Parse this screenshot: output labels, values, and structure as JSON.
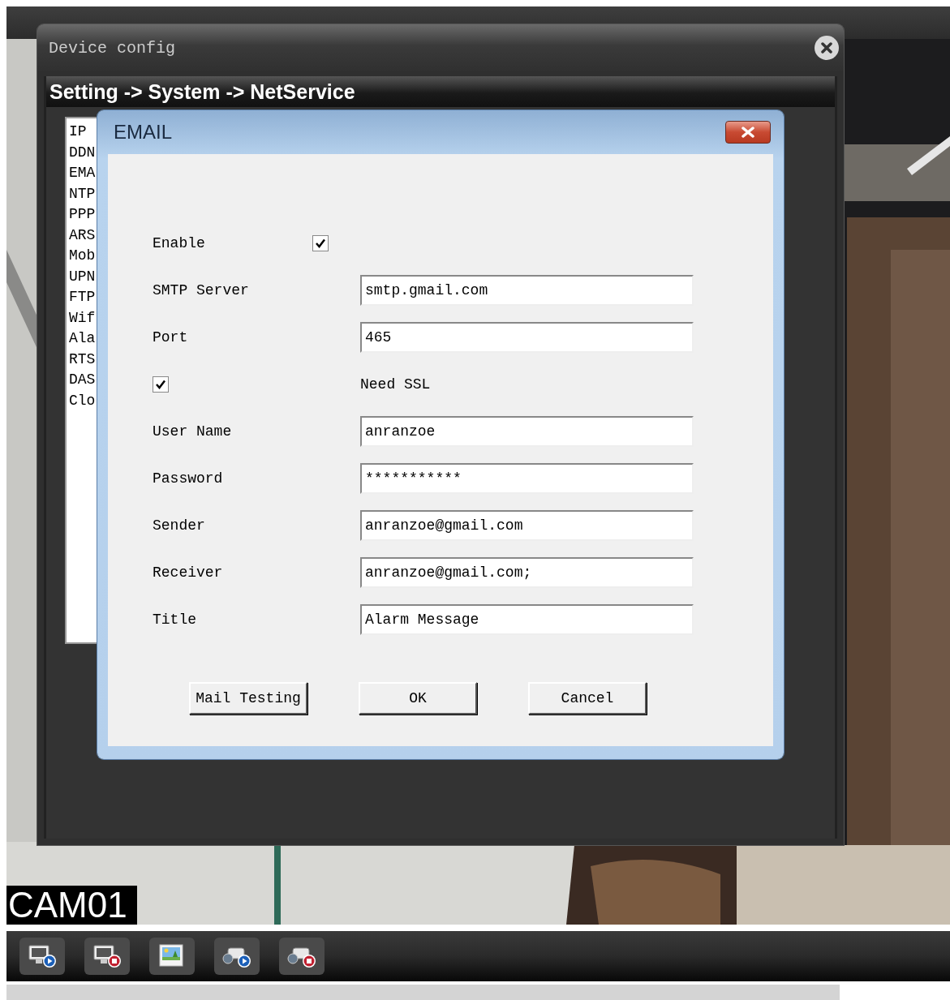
{
  "device_config": {
    "title": "Device config",
    "breadcrumb": "Setting -> System -> NetService",
    "services": [
      "IP",
      "DDN",
      "EMA",
      "NTP",
      "PPP",
      "ARS",
      "Mob",
      "UPN",
      "FTP",
      "Wif",
      "Ala",
      "RTS",
      "DAS",
      "Clo"
    ]
  },
  "email_dialog": {
    "title": "EMAIL",
    "rows": [
      {
        "kind": "checkbox",
        "label": "Enable",
        "checked": true
      },
      {
        "kind": "text",
        "label": "SMTP Server",
        "value": "smtp.gmail.com"
      },
      {
        "kind": "text",
        "label": "Port",
        "value": "465"
      },
      {
        "kind": "checkbox_first",
        "label": "Need SSL",
        "checked": true
      },
      {
        "kind": "text",
        "label": "User Name",
        "value": "anranzoe"
      },
      {
        "kind": "text",
        "label": "Password",
        "value": "***********"
      },
      {
        "kind": "text",
        "label": "Sender",
        "value": "anranzoe@gmail.com"
      },
      {
        "kind": "text",
        "label": "Receiver",
        "value": "anranzoe@gmail.com;"
      },
      {
        "kind": "text",
        "label": "Title",
        "value": "Alarm Message"
      }
    ],
    "buttons": [
      "Mail Testing",
      "OK",
      "Cancel"
    ]
  },
  "camera": {
    "label": "CAM01"
  },
  "toolbar": [
    {
      "kind": "monitor-play"
    },
    {
      "kind": "monitor-stop"
    },
    {
      "kind": "picture"
    },
    {
      "kind": "camera-play"
    },
    {
      "kind": "camera-stop"
    }
  ]
}
